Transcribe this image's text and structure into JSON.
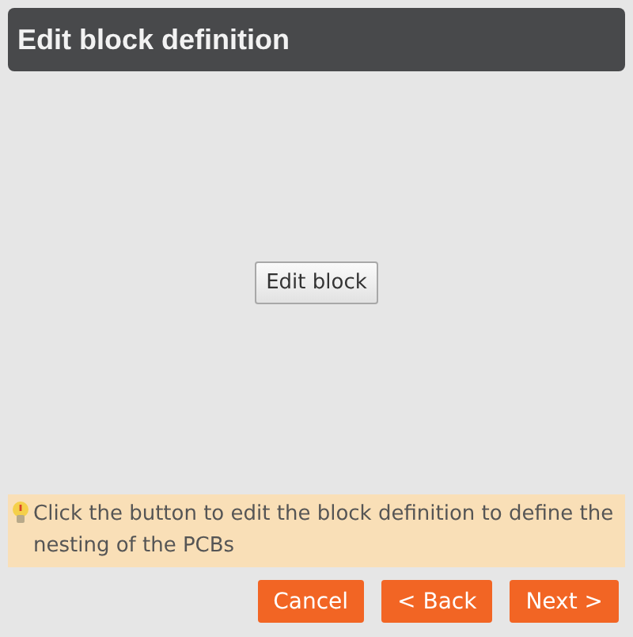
{
  "header": {
    "title": "Edit block definition"
  },
  "edit_button": {
    "label": "Edit block"
  },
  "hint": {
    "text": "Click the button to edit the block definition to define the nesting of the PCBs"
  },
  "buttons": [
    {
      "label": "Cancel"
    },
    {
      "label": "< Back"
    },
    {
      "label": "Next >"
    }
  ]
}
